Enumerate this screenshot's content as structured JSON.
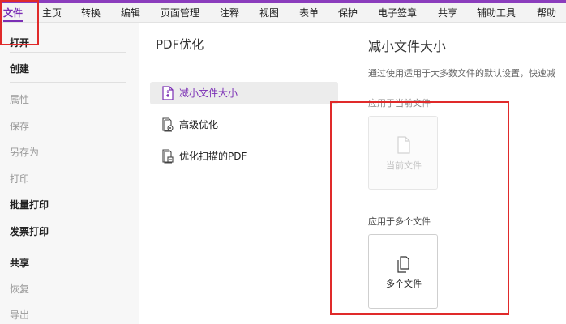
{
  "menubar": {
    "items": [
      {
        "label": "文件",
        "active": true
      },
      {
        "label": "主页"
      },
      {
        "label": "转换"
      },
      {
        "label": "编辑"
      },
      {
        "label": "页面管理"
      },
      {
        "label": "注释"
      },
      {
        "label": "视图"
      },
      {
        "label": "表单"
      },
      {
        "label": "保护"
      },
      {
        "label": "电子签章"
      },
      {
        "label": "共享"
      },
      {
        "label": "辅助工具"
      },
      {
        "label": "帮助"
      }
    ]
  },
  "sidebar": {
    "items": [
      {
        "label": "打开",
        "style": "bold"
      },
      {
        "label": "创建",
        "style": "bold"
      },
      {
        "label": "属性",
        "style": "dim"
      },
      {
        "label": "保存",
        "style": "dim"
      },
      {
        "label": "另存为",
        "style": "dim"
      },
      {
        "label": "打印",
        "style": "dim"
      },
      {
        "label": "批量打印",
        "style": "bold"
      },
      {
        "label": "发票打印",
        "style": "bold"
      },
      {
        "label": "共享",
        "style": "bold"
      },
      {
        "label": "恢复",
        "style": "dim"
      },
      {
        "label": "导出",
        "style": "dim"
      }
    ]
  },
  "middle": {
    "section_title": "PDF优化",
    "options": [
      {
        "label": "减小文件大小",
        "icon": "compress-file-icon",
        "selected": true
      },
      {
        "label": "高级优化",
        "icon": "advanced-optimize-icon"
      },
      {
        "label": "优化扫描的PDF",
        "icon": "scan-optimize-icon"
      }
    ]
  },
  "right": {
    "title": "减小文件大小",
    "description": "通过使用适用于大多数文件的默认设置，快速减",
    "current_label": "应用于当前文件",
    "current_card_label": "当前文件",
    "multi_label": "应用于多个文件",
    "multi_card_label": "多个文件"
  },
  "colors": {
    "accent": "#7b2fb5",
    "annotation": "#e02a2a"
  }
}
